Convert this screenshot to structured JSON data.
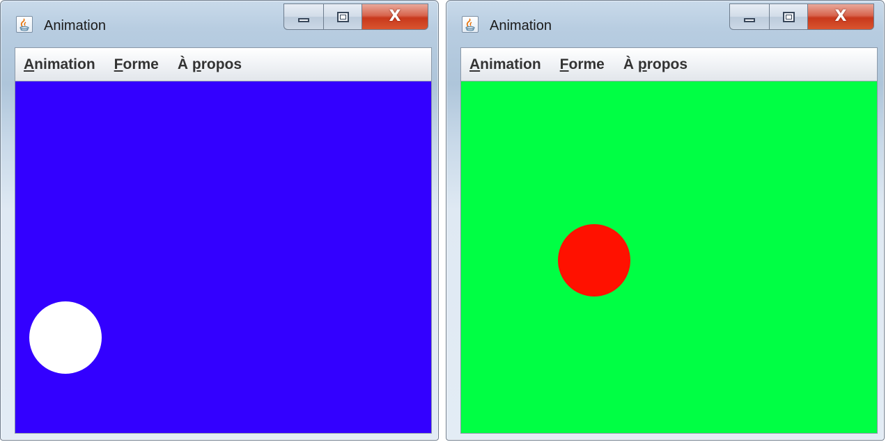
{
  "windows": [
    {
      "title": "Animation",
      "menu": [
        {
          "mnemonic": "A",
          "rest": "nimation"
        },
        {
          "mnemonic": "F",
          "rest": "orme"
        },
        {
          "pre": "À ",
          "mnemonic": "p",
          "rest": "ropos"
        }
      ],
      "canvas_color": "#3300ff",
      "ball_color": "#ffffff",
      "icons": [
        "java-icon",
        "minimize-icon",
        "maximize-icon",
        "close-icon"
      ]
    },
    {
      "title": "Animation",
      "menu": [
        {
          "mnemonic": "A",
          "rest": "nimation"
        },
        {
          "mnemonic": "F",
          "rest": "orme"
        },
        {
          "pre": "À ",
          "mnemonic": "p",
          "rest": "ropos"
        }
      ],
      "canvas_color": "#00ff44",
      "ball_color": "#ff1100",
      "icons": [
        "java-icon",
        "minimize-icon",
        "maximize-icon",
        "close-icon"
      ]
    }
  ],
  "close_glyph": "X"
}
